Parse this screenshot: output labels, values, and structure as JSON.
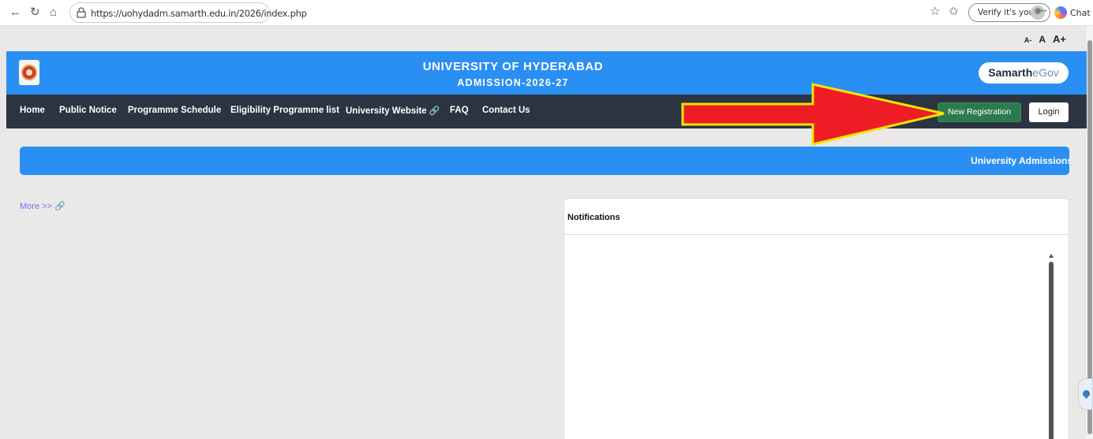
{
  "browser": {
    "url": "https://uohydadm.samarth.edu.in/2026/index.php",
    "verify_label": "Verify it's you",
    "more_label": "···",
    "chat_label": "Chat"
  },
  "font_controls": [
    "A-",
    "A",
    "A+"
  ],
  "header": {
    "title": "UNIVERSITY OF HYDERABAD",
    "subtitle": "ADMISSION-2026-27",
    "brand_part1": "Samarth",
    "brand_part2": "eGov",
    "color": "#2a8ff2"
  },
  "nav": {
    "items": [
      "Home",
      "Public Notice",
      "Programme Schedule",
      "Eligibility Programme list",
      "University Website",
      "FAQ",
      "Contact Us"
    ],
    "external_icon": "🔗",
    "register_label": "New Registration",
    "login_label": "Login"
  },
  "marquee": {
    "text": "University Admissions"
  },
  "more_link": {
    "label": "More >>"
  },
  "notifications": {
    "title": "Notifications"
  },
  "annotation": {
    "arrow_color": "#ee1c24",
    "arrow_outline": "#f3e500"
  }
}
